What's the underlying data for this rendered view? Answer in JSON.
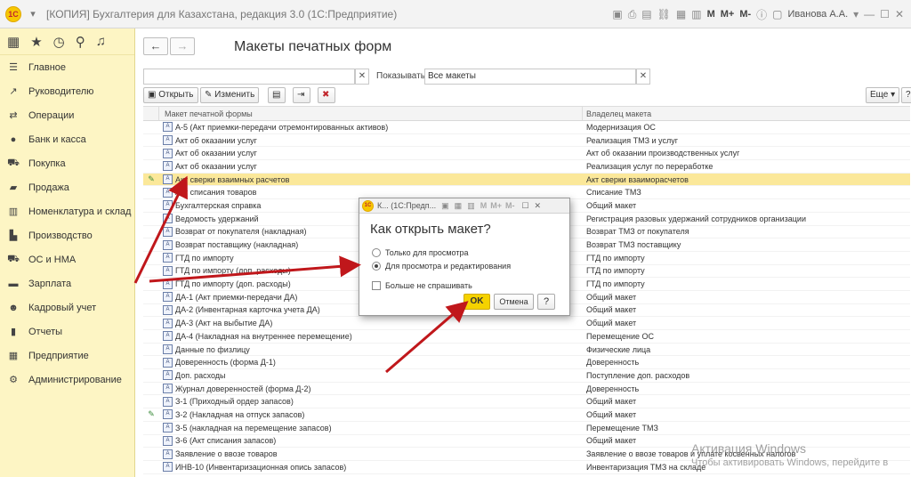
{
  "window": {
    "title": "[КОПИЯ] Бухгалтерия для Казахстана, редакция 3.0  (1С:Предприятие)",
    "logo_text": "1С",
    "m_buttons": [
      "M",
      "M+",
      "M-"
    ],
    "user": "Иванова А.А."
  },
  "sidebar": {
    "items": [
      {
        "label": "Главное",
        "icon": "menu-icon"
      },
      {
        "label": "Руководителю",
        "icon": "chart-icon"
      },
      {
        "label": "Операции",
        "icon": "operations-icon"
      },
      {
        "label": "Банк и касса",
        "icon": "coins-icon"
      },
      {
        "label": "Покупка",
        "icon": "cart-icon"
      },
      {
        "label": "Продажа",
        "icon": "bag-icon"
      },
      {
        "label": "Номенклатура и склад",
        "icon": "warehouse-icon"
      },
      {
        "label": "Производство",
        "icon": "factory-icon"
      },
      {
        "label": "ОС и НМА",
        "icon": "truck-icon"
      },
      {
        "label": "Зарплата",
        "icon": "money-icon"
      },
      {
        "label": "Кадровый учет",
        "icon": "people-icon"
      },
      {
        "label": "Отчеты",
        "icon": "bar-chart-icon"
      },
      {
        "label": "Предприятие",
        "icon": "building-icon"
      },
      {
        "label": "Администрирование",
        "icon": "gear-icon"
      }
    ]
  },
  "main": {
    "title": "Макеты печатных форм",
    "filter": {
      "label": "Показывать:",
      "value": "Все макеты"
    },
    "buttons": {
      "open": "Открыть",
      "edit": "Изменить",
      "more": "Еще",
      "help": "?"
    },
    "columns": {
      "name": "Макет печатной формы",
      "owner": "Владелец макета"
    },
    "rows": [
      {
        "name": "А-5 (Акт приемки-передачи отремонтированных активов)",
        "owner": "Модернизация ОС",
        "modified": false
      },
      {
        "name": "Акт об оказании услуг",
        "owner": "Реализация ТМЗ и услуг",
        "modified": false
      },
      {
        "name": "Акт об оказании услуг",
        "owner": "Акт об оказании производственных услуг",
        "modified": false
      },
      {
        "name": "Акт об оказании услуг",
        "owner": "Реализация услуг по переработке",
        "modified": false
      },
      {
        "name": "Акт сверки взаимных расчетов",
        "owner": "Акт сверки взаиморасчетов",
        "modified": true
      },
      {
        "name": "Акт списания товаров",
        "owner": "Списание ТМЗ",
        "modified": false
      },
      {
        "name": "Бухгалтерская справка",
        "owner": "Общий макет",
        "modified": false
      },
      {
        "name": "Ведомость удержаний",
        "owner": "Регистрация разовых удержаний сотрудников организации",
        "modified": false
      },
      {
        "name": "Возврат от покупателя (накладная)",
        "owner": "Возврат ТМЗ от покупателя",
        "modified": false
      },
      {
        "name": "Возврат поставщику (накладная)",
        "owner": "Возврат ТМЗ поставщику",
        "modified": false
      },
      {
        "name": "ГТД по импорту",
        "owner": "ГТД по импорту",
        "modified": false
      },
      {
        "name": "ГТД по импорту (доп. расходы)",
        "owner": "ГТД по импорту",
        "modified": false
      },
      {
        "name": "ГТД по импорту (доп. расходы)",
        "owner": "ГТД по импорту",
        "modified": false
      },
      {
        "name": "ДА-1 (Акт приемки-передачи ДА)",
        "owner": "Общий макет",
        "modified": false
      },
      {
        "name": "ДА-2 (Инвентарная карточка учета ДА)",
        "owner": "Общий макет",
        "modified": false
      },
      {
        "name": "ДА-3 (Акт на выбытие ДА)",
        "owner": "Общий макет",
        "modified": false
      },
      {
        "name": "ДА-4 (Накладная на внутреннее перемещение)",
        "owner": "Перемещение ОС",
        "modified": false
      },
      {
        "name": "Данные по физлицу",
        "owner": "Физические лица",
        "modified": false
      },
      {
        "name": "Доверенность (форма Д-1)",
        "owner": "Доверенность",
        "modified": false
      },
      {
        "name": "Доп. расходы",
        "owner": "Поступление доп. расходов",
        "modified": false
      },
      {
        "name": "Журнал доверенностей (форма Д-2)",
        "owner": "Доверенность",
        "modified": false
      },
      {
        "name": "З-1 (Приходный ордер запасов)",
        "owner": "Общий макет",
        "modified": false
      },
      {
        "name": "З-2 (Накладная на отпуск запасов)",
        "owner": "Общий макет",
        "modified": true
      },
      {
        "name": "З-5 (накладная на перемещение запасов)",
        "owner": "Перемещение ТМЗ",
        "modified": false
      },
      {
        "name": "З-6 (Акт списания запасов)",
        "owner": "Общий макет",
        "modified": false
      },
      {
        "name": "Заявление о ввозе товаров",
        "owner": "Заявление о ввозе товаров и уплате косвенных налогов",
        "modified": false
      },
      {
        "name": "ИНВ-10 (Инвентаризационная опись запасов)",
        "owner": "Инвентаризация ТМЗ на складе",
        "modified": false
      }
    ]
  },
  "dialog": {
    "title": "К...  (1С:Предп...",
    "question": "Как открыть макет?",
    "option_view": "Только для просмотра",
    "option_edit": "Для просмотра и редактирования",
    "dont_ask": "Больше не спрашивать",
    "ok": "OK",
    "cancel": "Отмена",
    "help": "?"
  },
  "watermark": {
    "line1": "Активация Windows",
    "line2": "Чтобы активировать Windows, перейдите в"
  },
  "accent_colors": {
    "sidebar": "#fdf5c4",
    "selected_row": "#fbe89a",
    "ok_button": "#f5d200",
    "arrow": "#c0171b"
  }
}
